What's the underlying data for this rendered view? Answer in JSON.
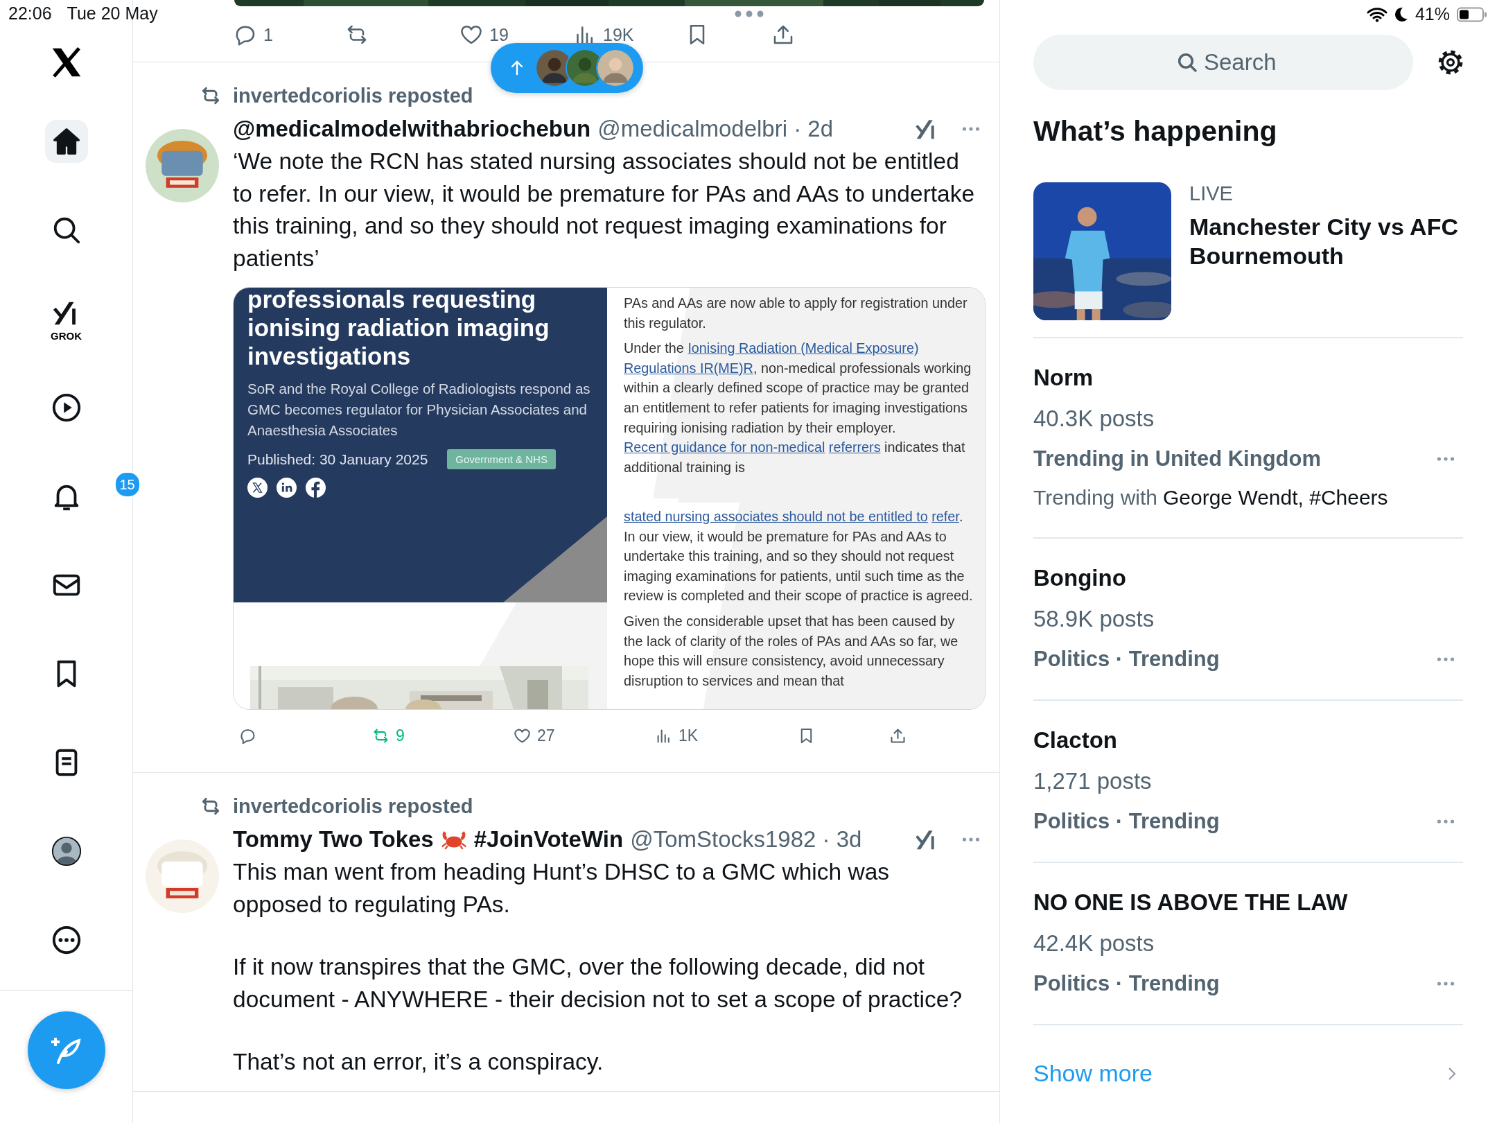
{
  "status_bar": {
    "time": "22:06",
    "date": "Tue 20 May",
    "battery": "41%"
  },
  "nav": {
    "items": [
      {
        "kind": "logo",
        "selected": false
      },
      {
        "kind": "home",
        "selected": true
      },
      {
        "kind": "search",
        "selected": false
      },
      {
        "kind": "grok",
        "label": "GROK",
        "selected": false
      },
      {
        "kind": "video",
        "selected": false
      },
      {
        "kind": "notifications",
        "badge": "15",
        "selected": false
      },
      {
        "kind": "messages",
        "selected": false
      },
      {
        "kind": "bookmarks",
        "selected": false
      },
      {
        "kind": "lists",
        "selected": false
      },
      {
        "kind": "profile",
        "selected": false
      },
      {
        "kind": "more",
        "selected": false
      }
    ]
  },
  "previous_post": {
    "actions": [
      {
        "kind": "reply",
        "count": "1",
        "active": false
      },
      {
        "kind": "repost",
        "active": false
      },
      {
        "kind": "like",
        "count": "19",
        "active": false
      },
      {
        "kind": "views",
        "count": "19K",
        "active": false
      },
      {
        "kind": "bookmark",
        "active": false
      },
      {
        "kind": "share",
        "active": false
      }
    ]
  },
  "posts": [
    {
      "reposted_by": "invertedcoriolis reposted",
      "name": "@medicalmodelwithabriochebun",
      "handle_time": "@medicalmodelbri · 2d",
      "text": [
        "‘We note the RCN has stated nursing associates should not be entitled to refer. In our view, it would be premature for PAs and AAs to undertake this training, and so they should not request imaging examinations for patients’"
      ],
      "embed": {
        "title": "professionals requesting ionising radiation imaging investigations",
        "subtitle": "SoR and the Royal College of Radiologists respond as GMC becomes regulator for Physician Associates and Anaesthesia Associates",
        "published": "Published: 30 January 2025",
        "tag": "Government & NHS",
        "sections": [
          {
            "paragraphs": [
              [
                {
                  "text": "PAs and AAs are now able to apply for registration under this regulator."
                }
              ],
              [
                {
                  "text": "Under the "
                },
                {
                  "text": "Ionising Radiation (Medical Exposure)",
                  "link": true
                },
                {
                  "text": "Regulations IR(ME)R",
                  "link": true
                },
                {
                  "text": ", non-medical professionals working within a clearly defined scope of practice may be granted an entitlement to refer patients for imaging investigations requiring ionising radiation by their employer. "
                },
                {
                  "text": "Recent guidance for non-medical",
                  "link": true
                },
                {
                  "text": "referrers",
                  "link": true
                },
                {
                  "text": " indicates that additional training is"
                }
              ]
            ]
          },
          {
            "paragraphs": [
              [
                {
                  "text": "stated nursing associates should not be entitled to",
                  "link": true
                },
                {
                  "text": "refer",
                  "link": true
                },
                {
                  "text": ". In our view, it would be premature for PAs and AAs to undertake this training, and so they should not request imaging examinations for patients, until such time as the review is completed and their scope of practice is agreed."
                }
              ],
              [
                {
                  "text": "Given the considerable upset that has been caused by the lack of clarity of the roles of PAs and AAs so far, we hope this will ensure consistency, avoid unnecessary disruption to services and mean that"
                }
              ]
            ]
          }
        ]
      },
      "actions": [
        {
          "kind": "reply",
          "active": false
        },
        {
          "kind": "repost",
          "count": "9",
          "active": true
        },
        {
          "kind": "like",
          "count": "27",
          "active": false
        },
        {
          "kind": "views",
          "count": "1K",
          "active": false
        },
        {
          "kind": "bookmark",
          "active": false
        },
        {
          "kind": "share",
          "active": false
        }
      ]
    },
    {
      "reposted_by": "invertedcoriolis reposted",
      "name": "Tommy Two Tokes",
      "name_tag": "#JoinVoteWin",
      "handle_time": "@TomStocks1982 · 3d",
      "text": [
        "This man went from heading Hunt’s DHSC to a GMC which was opposed to regulating PAs.",
        "If it now transpires that the GMC, over the following decade, did not document - ANYWHERE - their decision not to set a scope of practice?",
        "That’s not an error, it’s a conspiracy."
      ]
    }
  ],
  "sidebar": {
    "search": {
      "placeholder": "Search"
    },
    "heading": "What’s happening",
    "featured": {
      "status": "LIVE",
      "title": "Manchester City vs AFC Bournemouth"
    },
    "trends": [
      {
        "topic": "Norm",
        "posts": "40.3K posts",
        "context": "Trending in United Kingdom",
        "with_label": "Trending with",
        "with_names": "George Wendt, #Cheers"
      },
      {
        "topic": "Bongino",
        "posts": "58.9K posts",
        "context": "Politics · Trending"
      },
      {
        "topic": "Clacton",
        "posts": "1,271 posts",
        "context": "Politics · Trending"
      },
      {
        "topic": "NO ONE IS ABOVE THE LAW",
        "posts": "42.4K posts",
        "context": "Politics · Trending"
      }
    ],
    "show_more": "Show more"
  }
}
